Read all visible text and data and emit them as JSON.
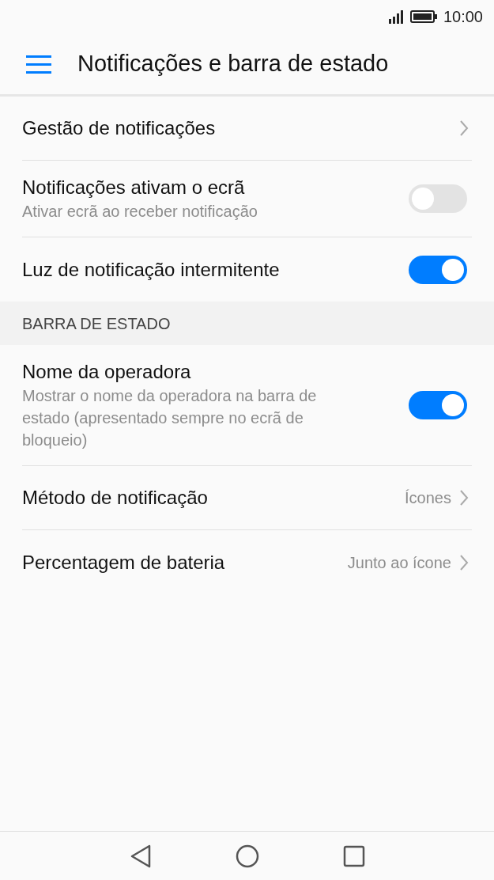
{
  "status_bar": {
    "time": "10:00"
  },
  "header": {
    "title": "Notificações e barra de estado"
  },
  "rows": [
    {
      "kind": "link",
      "title": "Gestão de notificações"
    },
    {
      "kind": "toggle",
      "title": "Notificações ativam o ecrã",
      "subtitle": "Ativar ecrã ao receber notificação",
      "on": false
    },
    {
      "kind": "toggle",
      "title": "Luz de notificação intermitente",
      "on": true
    },
    {
      "kind": "section",
      "title": "BARRA DE ESTADO"
    },
    {
      "kind": "toggle",
      "title": "Nome da operadora",
      "subtitle": "Mostrar o nome da operadora na barra de estado (apresentado sempre no ecrã de bloqueio)",
      "on": true
    },
    {
      "kind": "link",
      "title": "Método de notificação",
      "value": "Ícones"
    },
    {
      "kind": "link",
      "title": "Percentagem de bateria",
      "value": "Junto ao ícone"
    }
  ]
}
